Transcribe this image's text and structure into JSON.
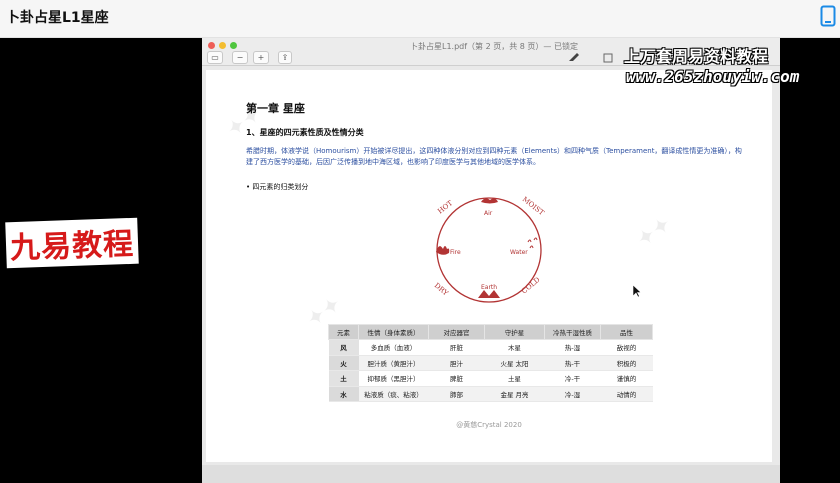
{
  "header": {
    "title": "卜卦占星L1星座"
  },
  "viewer": {
    "doc_title": "卜卦占星L1.pdf（第 2 页，共 8 页）— 已锁定",
    "toolbar": {
      "zoom_out": "−",
      "zoom_in": "+",
      "share": "⇪",
      "sidebar": "▭"
    }
  },
  "page": {
    "chapter": "第一章 星座",
    "section": "1、星座的四元素性质及性情分类",
    "paragraph": "希腊时期，体液学说（Homourism）开始被详尽提出，这四种体液分别对应到四种元素（Elements）和四种气质（Temperament，翻译成性情更为准确），构建了西方医学的基础，后因广泛传播到地中海区域，也影响了印度医学与其他地域的医学体系。",
    "bullet": "• 四元素的归类划分",
    "wheel": {
      "hot": "HOT",
      "moist": "MOIST",
      "dry": "DRY",
      "cold": "COLD",
      "air": "Air",
      "fire": "Fire",
      "water": "Water",
      "earth": "Earth"
    },
    "table": {
      "headers": [
        "元素",
        "性情（身体素质）",
        "对应器官",
        "守护星",
        "冷热干湿性质",
        "品性"
      ],
      "rows": [
        [
          "风",
          "多血质（血液）",
          "肝脏",
          "木星",
          "热-湿",
          "敌视的"
        ],
        [
          "火",
          "胆汁质（黄胆汁）",
          "胆汁",
          "火星 太阳",
          "热-干",
          "积极的"
        ],
        [
          "土",
          "抑郁质（黑胆汁）",
          "脾脏",
          "土星",
          "冷-干",
          "谨慎的"
        ],
        [
          "水",
          "粘液质（痰、粘液）",
          "肺部",
          "金星 月亮",
          "冷-湿",
          "动情的"
        ]
      ]
    },
    "footer": "@黄慈Crystal 2020"
  },
  "overlay": {
    "brand": "上万套周易资料教程",
    "url": "www.265zhouyiw.com",
    "logo": "九易教程"
  },
  "colors": {
    "accent_blue": "#2c4fa0",
    "wheel_red": "#b23434",
    "logo_red": "#d61a1a"
  }
}
